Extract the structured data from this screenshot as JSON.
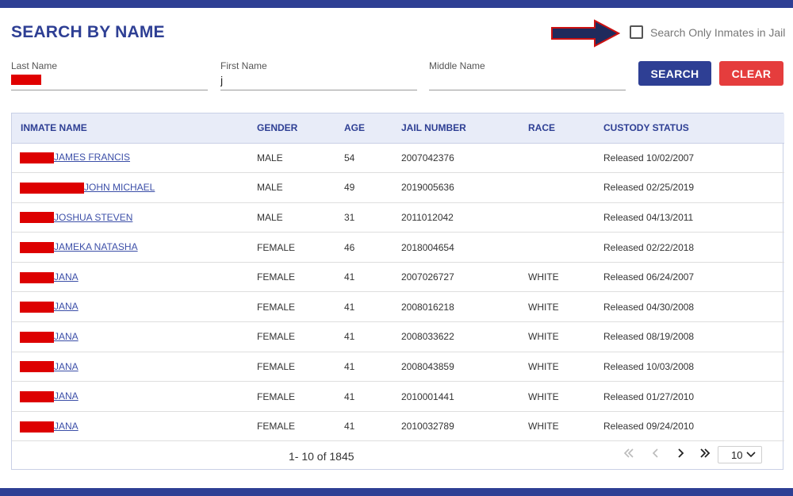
{
  "header": {
    "title": "SEARCH BY NAME",
    "jail_only_label": "Search Only Inmates in Jail",
    "jail_only_checked": false
  },
  "form": {
    "last_name_label": "Last Name",
    "last_name_value": "",
    "first_name_label": "First Name",
    "first_name_value": "j",
    "middle_name_label": "Middle Name",
    "middle_name_value": "",
    "search_label": "SEARCH",
    "clear_label": "CLEAR"
  },
  "table": {
    "columns": [
      "INMATE NAME",
      "GENDER",
      "AGE",
      "JAIL NUMBER",
      "RACE",
      "CUSTODY STATUS"
    ],
    "rows": [
      {
        "name": "JAMES FRANCIS",
        "gender": "MALE",
        "age": "54",
        "jail_number": "2007042376",
        "race": "",
        "status": "Released 10/02/2007"
      },
      {
        "name": "JOHN MICHAEL",
        "gender": "MALE",
        "age": "49",
        "jail_number": "2019005636",
        "race": "",
        "status": "Released 02/25/2019"
      },
      {
        "name": "JOSHUA STEVEN",
        "gender": "MALE",
        "age": "31",
        "jail_number": "2011012042",
        "race": "",
        "status": "Released 04/13/2011"
      },
      {
        "name": "JAMEKA NATASHA",
        "gender": "FEMALE",
        "age": "46",
        "jail_number": "2018004654",
        "race": "",
        "status": "Released 02/22/2018"
      },
      {
        "name": "JANA",
        "gender": "FEMALE",
        "age": "41",
        "jail_number": "2007026727",
        "race": "WHITE",
        "status": "Released 06/24/2007"
      },
      {
        "name": "JANA",
        "gender": "FEMALE",
        "age": "41",
        "jail_number": "2008016218",
        "race": "WHITE",
        "status": "Released 04/30/2008"
      },
      {
        "name": "JANA",
        "gender": "FEMALE",
        "age": "41",
        "jail_number": "2008033622",
        "race": "WHITE",
        "status": "Released 08/19/2008"
      },
      {
        "name": "JANA",
        "gender": "FEMALE",
        "age": "41",
        "jail_number": "2008043859",
        "race": "WHITE",
        "status": "Released 10/03/2008"
      },
      {
        "name": "JANA",
        "gender": "FEMALE",
        "age": "41",
        "jail_number": "2010001441",
        "race": "WHITE",
        "status": "Released 01/27/2010"
      },
      {
        "name": "JANA",
        "gender": "FEMALE",
        "age": "41",
        "jail_number": "2010032789",
        "race": "WHITE",
        "status": "Released 09/24/2010"
      }
    ]
  },
  "pagination": {
    "range_text": "1- 10 of 1845",
    "first_icon": "double-chevron-left-icon",
    "prev_icon": "chevron-left-icon",
    "next_icon": "chevron-right-icon",
    "last_icon": "double-chevron-right-icon",
    "page_size": "10"
  },
  "colors": {
    "brand_navy": "#2e3f94",
    "clear_red": "#e53d3d",
    "redaction_red": "#dd0000",
    "header_row_bg": "#e8ecf8"
  }
}
